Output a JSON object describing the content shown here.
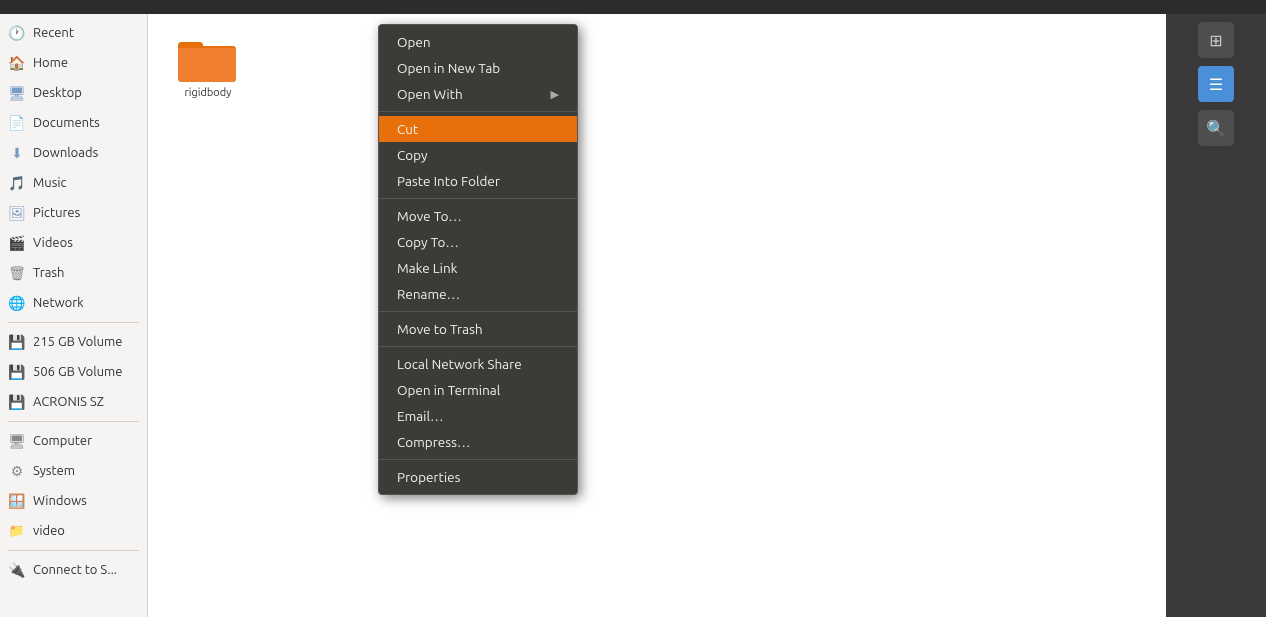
{
  "titlebar": {},
  "sidebar": {
    "items": [
      {
        "id": "recent",
        "label": "Recent",
        "icon": "🕐"
      },
      {
        "id": "home",
        "label": "Home",
        "icon": "🏠"
      },
      {
        "id": "desktop",
        "label": "Desktop",
        "icon": "🖥"
      },
      {
        "id": "documents",
        "label": "Documents",
        "icon": "📄"
      },
      {
        "id": "downloads",
        "label": "Downloads",
        "icon": "⬇"
      },
      {
        "id": "music",
        "label": "Music",
        "icon": "🎵"
      },
      {
        "id": "pictures",
        "label": "Pictures",
        "icon": "🖼"
      },
      {
        "id": "videos",
        "label": "Videos",
        "icon": "🎬"
      },
      {
        "id": "trash",
        "label": "Trash",
        "icon": "🗑"
      },
      {
        "id": "network",
        "label": "Network",
        "icon": "🌐"
      }
    ],
    "drives": [
      {
        "id": "215gb",
        "label": "215 GB Volume",
        "icon": "💾"
      },
      {
        "id": "506gb",
        "label": "506 GB Volume",
        "icon": "💾"
      },
      {
        "id": "acronis",
        "label": "ACRONIS SZ",
        "icon": "💾"
      }
    ],
    "other": [
      {
        "id": "computer",
        "label": "Computer",
        "icon": "🖥"
      },
      {
        "id": "system",
        "label": "System",
        "icon": "⚙"
      },
      {
        "id": "windows",
        "label": "Windows",
        "icon": "🪟"
      },
      {
        "id": "video",
        "label": "video",
        "icon": "📁"
      }
    ],
    "connect": {
      "label": "Connect to S...",
      "icon": "🔌"
    }
  },
  "folder": {
    "name": "rigidbody"
  },
  "context_menu": {
    "items": [
      {
        "id": "open",
        "label": "Open",
        "has_submenu": false,
        "separator_after": false
      },
      {
        "id": "open-new-tab",
        "label": "Open in New Tab",
        "has_submenu": false,
        "separator_after": false
      },
      {
        "id": "open-with",
        "label": "Open With",
        "has_submenu": true,
        "separator_after": true
      },
      {
        "id": "cut",
        "label": "Cut",
        "has_submenu": false,
        "separator_after": false,
        "active": true
      },
      {
        "id": "copy",
        "label": "Copy",
        "has_submenu": false,
        "separator_after": false
      },
      {
        "id": "paste-into-folder",
        "label": "Paste Into Folder",
        "has_submenu": false,
        "separator_after": true
      },
      {
        "id": "move-to",
        "label": "Move To…",
        "has_submenu": false,
        "separator_after": false
      },
      {
        "id": "copy-to",
        "label": "Copy To…",
        "has_submenu": false,
        "separator_after": false
      },
      {
        "id": "make-link",
        "label": "Make Link",
        "has_submenu": false,
        "separator_after": false
      },
      {
        "id": "rename",
        "label": "Rename…",
        "has_submenu": false,
        "separator_after": true
      },
      {
        "id": "move-to-trash",
        "label": "Move to Trash",
        "has_submenu": false,
        "separator_after": true
      },
      {
        "id": "local-network-share",
        "label": "Local Network Share",
        "has_submenu": false,
        "separator_after": false
      },
      {
        "id": "open-in-terminal",
        "label": "Open in Terminal",
        "has_submenu": false,
        "separator_after": false
      },
      {
        "id": "email",
        "label": "Email…",
        "has_submenu": false,
        "separator_after": false
      },
      {
        "id": "compress",
        "label": "Compress…",
        "has_submenu": false,
        "separator_after": true
      },
      {
        "id": "properties",
        "label": "Properties",
        "has_submenu": false,
        "separator_after": false
      }
    ]
  },
  "right_panel": {
    "buttons": [
      {
        "id": "icon-view",
        "icon": "⊞",
        "active": false
      },
      {
        "id": "list-view",
        "icon": "☰",
        "active": false
      },
      {
        "id": "zoom",
        "icon": "🔍",
        "active": false
      }
    ]
  }
}
